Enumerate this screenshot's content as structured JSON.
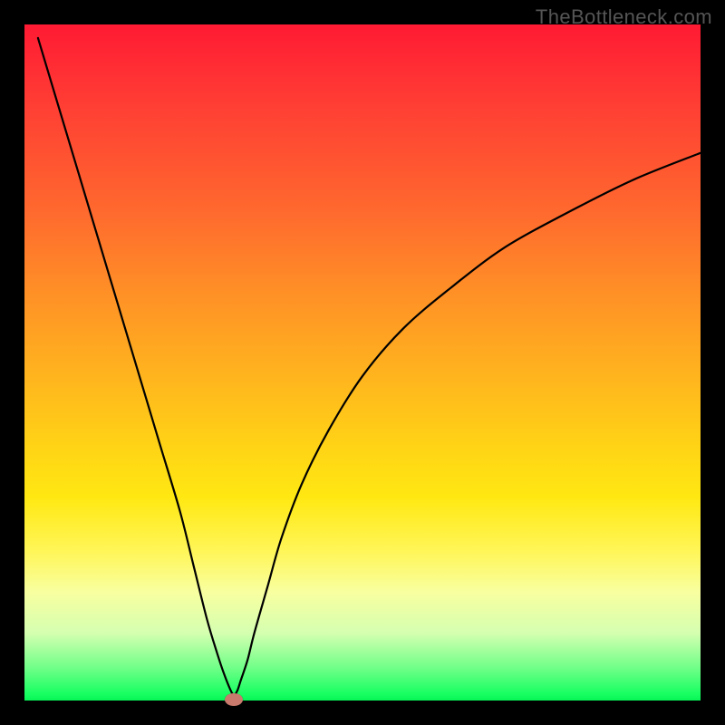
{
  "watermark": "TheBottleneck.com",
  "chart_data": {
    "type": "line",
    "title": "",
    "xlabel": "",
    "ylabel": "",
    "xlim": [
      0,
      100
    ],
    "ylim": [
      0,
      100
    ],
    "x": [
      2,
      5,
      8,
      11,
      14,
      17,
      20,
      23,
      25,
      27,
      28.5,
      29.5,
      30.5,
      31,
      31.5,
      32,
      33,
      34,
      36,
      38,
      41,
      45,
      50,
      56,
      63,
      71,
      80,
      90,
      100
    ],
    "y": [
      98,
      88,
      78,
      68,
      58,
      48,
      38,
      28,
      20,
      12,
      7,
      4,
      1.5,
      0.8,
      1.5,
      3,
      6,
      10,
      17,
      24,
      32,
      40,
      48,
      55,
      61,
      67,
      72,
      77,
      81
    ],
    "marker": {
      "x": 31,
      "y": 0
    },
    "background_gradient": {
      "top": "#ff1a33",
      "bottom": "#18ff62"
    },
    "annotations": []
  }
}
